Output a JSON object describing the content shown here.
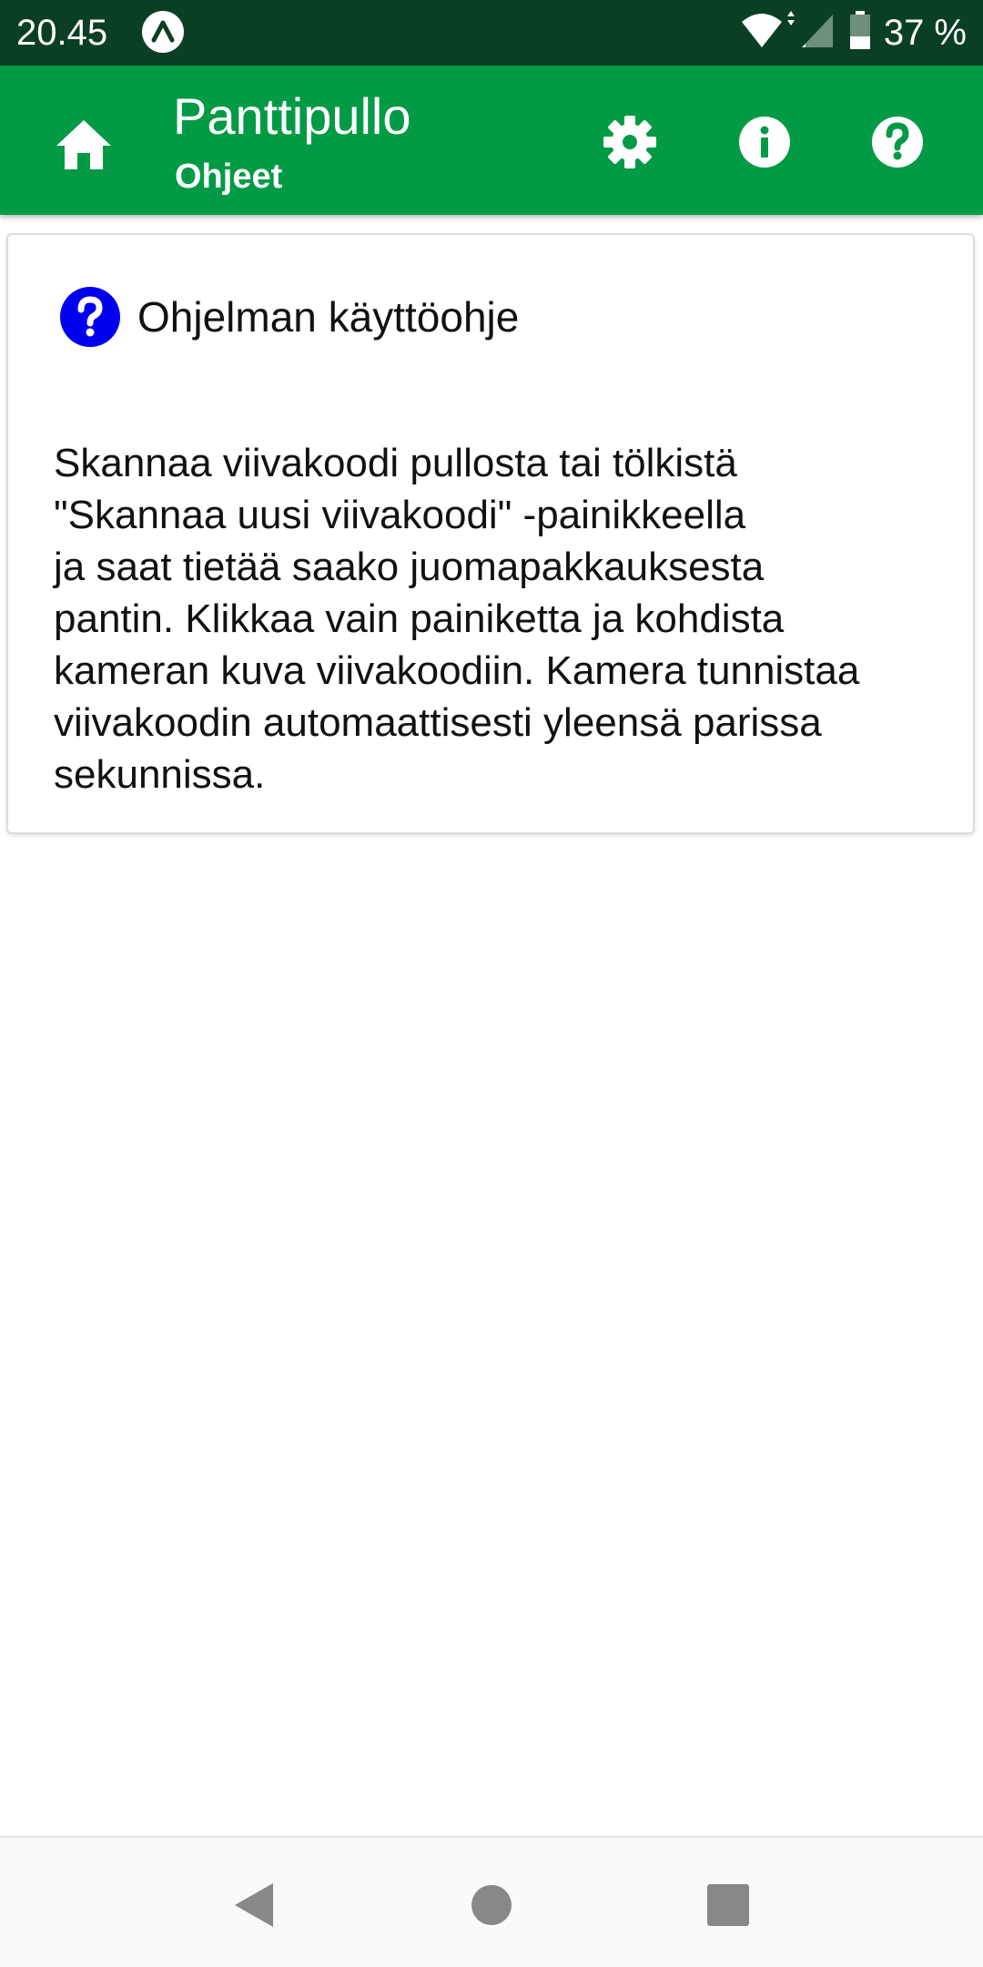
{
  "status_bar": {
    "time": "20.45",
    "battery_percent": "37 %",
    "app_icon": "expo-icon",
    "wifi_icon": "wifi-icon",
    "signal_icon": "cell-signal-icon",
    "battery_icon": "battery-icon"
  },
  "app_bar": {
    "title": "Panttipullo",
    "subtitle": "Ohjeet",
    "home_icon": "home-icon",
    "settings_icon": "gear-icon",
    "info_icon": "info-icon",
    "help_icon": "help-icon",
    "background_color": "#039a46"
  },
  "card": {
    "icon": "question-circle-icon",
    "icon_color": "#0000ee",
    "title": "Ohjelman käyttöohje",
    "body_lines": [
      "Skannaa viivakoodi pullosta tai tölkistä",
      "\"Skannaa uusi viivakoodi\" -painikkeella",
      "ja saat tietää saako juomapakkauksesta",
      "pantin. Klikkaa vain painiketta ja kohdista",
      "kameran kuva viivakoodiin. Kamera tunnistaa",
      "viivakoodin automaattisesti yleensä parissa",
      "sekunnissa."
    ]
  },
  "nav_bar": {
    "back_icon": "back-triangle-icon",
    "home_icon": "home-circle-icon",
    "recents_icon": "recents-square-icon"
  }
}
